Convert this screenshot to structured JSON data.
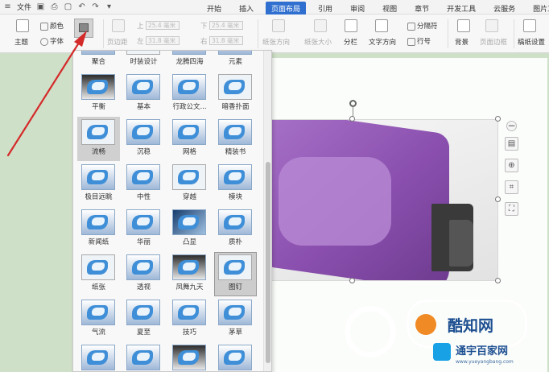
{
  "menubar": {
    "file_label": "文件",
    "tabs": [
      {
        "label": "开始",
        "active": false
      },
      {
        "label": "插入",
        "active": false
      },
      {
        "label": "页面布局",
        "active": true
      },
      {
        "label": "引用",
        "active": false
      },
      {
        "label": "审阅",
        "active": false
      },
      {
        "label": "视图",
        "active": false
      },
      {
        "label": "章节",
        "active": false
      },
      {
        "label": "开发工具",
        "active": false
      },
      {
        "label": "云服务",
        "active": false
      },
      {
        "label": "图片工具",
        "active": false
      }
    ]
  },
  "ribbon": {
    "theme_label": "主题",
    "color_label": "颜色",
    "font_label": "字体",
    "margin_label": "页边距",
    "top_label": "上",
    "bottom_label": "下",
    "left_label": "左",
    "right_label": "右",
    "top_value": "25.4 毫米",
    "bottom_value": "25.4 毫米",
    "left_value": "31.8 毫米",
    "right_value": "31.8 毫米",
    "orientation_label": "纸张方向",
    "size_label": "纸张大小",
    "columns_label": "分栏",
    "text_direction_label": "文字方向",
    "separator_label": "分隔符",
    "line_number_label": "行号",
    "background_label": "背景",
    "border_label": "页面边框",
    "paper_setting_label": "稿纸设置"
  },
  "gallery": {
    "items": [
      {
        "label": "聚合",
        "variant": "v2"
      },
      {
        "label": "时装设计",
        "variant": "v3"
      },
      {
        "label": "龙腾四海",
        "variant": "v2"
      },
      {
        "label": "元素",
        "variant": "v2"
      },
      {
        "label": "平衡",
        "variant": "v1"
      },
      {
        "label": "基本",
        "variant": "v2"
      },
      {
        "label": "行政公文...",
        "variant": "v2"
      },
      {
        "label": "暗香扑面",
        "variant": "v3"
      },
      {
        "label": "流畅",
        "variant": "v3",
        "selected": true
      },
      {
        "label": "沉稳",
        "variant": "v2"
      },
      {
        "label": "网格",
        "variant": "v2"
      },
      {
        "label": "精装书",
        "variant": "v2"
      },
      {
        "label": "极目远眺",
        "variant": "v2"
      },
      {
        "label": "中性",
        "variant": "v2"
      },
      {
        "label": "穿越",
        "variant": "v3"
      },
      {
        "label": "模块",
        "variant": "v2"
      },
      {
        "label": "新闻纸",
        "variant": "v2"
      },
      {
        "label": "华丽",
        "variant": "v2"
      },
      {
        "label": "凸显",
        "variant": "v4"
      },
      {
        "label": "质朴",
        "variant": "v2"
      },
      {
        "label": "纸张",
        "variant": "v3"
      },
      {
        "label": "透视",
        "variant": "v2"
      },
      {
        "label": "凤舞九天",
        "variant": "v1"
      },
      {
        "label": "图钉",
        "variant": "v3",
        "hover": true
      },
      {
        "label": "气流",
        "variant": "v2"
      },
      {
        "label": "夏至",
        "variant": "v2"
      },
      {
        "label": "技巧",
        "variant": "v2"
      },
      {
        "label": "茅草",
        "variant": "v2"
      },
      {
        "label": "",
        "variant": "v2"
      },
      {
        "label": "",
        "variant": "v2"
      },
      {
        "label": "",
        "variant": "v1"
      },
      {
        "label": "",
        "variant": "v2"
      }
    ]
  },
  "watermark": {
    "brand": "酷知网",
    "sub": "通宇百家网",
    "url": "www.yueyangbang.com"
  }
}
